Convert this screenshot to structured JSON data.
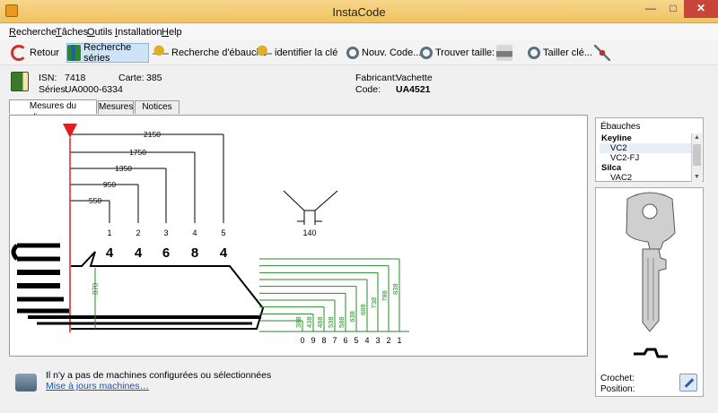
{
  "window": {
    "title": "InstaCode",
    "minimize": "—",
    "maximize": "□",
    "close": "✕"
  },
  "menu": [
    "Recherche",
    "Tâches",
    "Outils",
    "Installation",
    "Help"
  ],
  "toolbar": {
    "back": "Retour",
    "search_series": "Recherche séries",
    "search_blank": "Recherche d'ébauche",
    "identify_key": "identifier la  clé",
    "new_code": "Nouv. Code...",
    "find_size": "Trouver taille:",
    "cut_key": "Tailler clé...",
    "icons": [
      "back-arrow-icon",
      "books-icon",
      "keys-icon",
      "key-search-icon",
      "new-code-icon",
      "magnify-icon",
      "printer-icon",
      "cut-key-icon",
      "tools-icon"
    ]
  },
  "info": {
    "isn_label": "ISN:",
    "isn": "7418",
    "carte_label": "Carte:",
    "carte": "385",
    "series_label": "Séries:",
    "series": "UA0000-6334",
    "fabricant_label": "Fabricant:",
    "fabricant": "Vachette",
    "code_label": "Code:",
    "code": "UA4521"
  },
  "tabs": [
    "Mesures du diagramme",
    "Mesures",
    "Notices etc"
  ],
  "diagram": {
    "spacings": [
      "2150",
      "1750",
      "1350",
      "950",
      "550"
    ],
    "positions": [
      "1",
      "2",
      "3",
      "4",
      "5"
    ],
    "cuts": [
      "4",
      "4",
      "6",
      "8",
      "4"
    ],
    "angle_width": "140",
    "shoulder_height": "870",
    "depths": [
      "388",
      "438",
      "488",
      "538",
      "588",
      "638",
      "688",
      "738",
      "788",
      "838"
    ],
    "depth_numbers": [
      "0",
      "9",
      "8",
      "7",
      "6",
      "5",
      "4",
      "3",
      "2",
      "1"
    ],
    "colors": {
      "dims": "#000000",
      "pointer": "#e02020",
      "depth_lines": "#2a8a2a",
      "key": "#000000"
    }
  },
  "status": {
    "message": "Il n'y a pas de machines configurées ou sélectionnées",
    "link": "Mise à jours machines…"
  },
  "blanks": {
    "header": "Ébauches",
    "items": [
      {
        "label": "Keyline",
        "type": "group"
      },
      {
        "label": "VC2",
        "type": "child"
      },
      {
        "label": "VC2-FJ",
        "type": "child"
      },
      {
        "label": "Silca",
        "type": "group"
      },
      {
        "label": "VAC2",
        "type": "child"
      }
    ]
  },
  "key_panel": {
    "crochet_label": "Crochet:",
    "position_label": "Position:"
  }
}
